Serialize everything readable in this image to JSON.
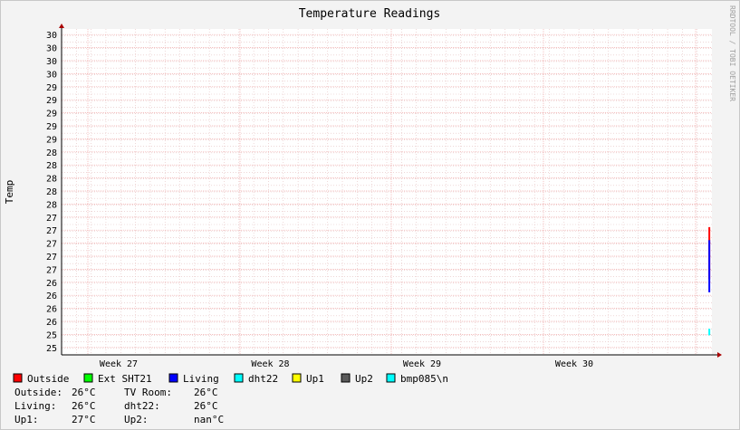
{
  "chart_data": {
    "type": "line",
    "title": "Temperature Readings",
    "ylabel": "Temp",
    "xlabel": "",
    "watermark": "RRDTOOL / TOBI OETIKER",
    "ylim": [
      25,
      30
    ],
    "y_tick_labels": [
      "25",
      "25",
      "26",
      "26",
      "26",
      "26",
      "27",
      "27",
      "27",
      "27",
      "27",
      "28",
      "28",
      "28",
      "28",
      "28",
      "29",
      "29",
      "29",
      "29",
      "29",
      "30",
      "30",
      "30",
      "30"
    ],
    "x_tick_labels": [
      "Week 27",
      "Week 28",
      "Week 29",
      "Week 30"
    ],
    "series": [
      {
        "name": "Outside",
        "color": "#ff0000",
        "x": [
          0.996,
          0.996
        ],
        "values": [
          26.96,
          26.16
        ]
      },
      {
        "name": "Ext SHT21",
        "color": "#00ff00",
        "x": [],
        "values": []
      },
      {
        "name": "Living",
        "color": "#0000ff",
        "x": [
          0.996,
          0.996
        ],
        "values": [
          26.76,
          25.96
        ]
      },
      {
        "name": "dht22",
        "color": "#00ffff",
        "x": [
          0.996,
          0.996
        ],
        "values": [
          25.4,
          25.3
        ]
      },
      {
        "name": "Up1",
        "color": "#ffff00",
        "x": [],
        "values": []
      },
      {
        "name": "Up2",
        "color": "#5a5a5a",
        "x": [],
        "values": []
      },
      {
        "name": "bmp085\\n",
        "color": "#00ffff",
        "x": [],
        "values": []
      }
    ],
    "grid": true,
    "legend": "bottom-left"
  },
  "summary": [
    [
      "Outside:",
      "26°C",
      "TV Room:",
      "26°C"
    ],
    [
      "Living:",
      "26°C",
      "dht22:",
      "26°C"
    ],
    [
      "Up1:",
      "27°C",
      "Up2:",
      "nan°C"
    ]
  ]
}
